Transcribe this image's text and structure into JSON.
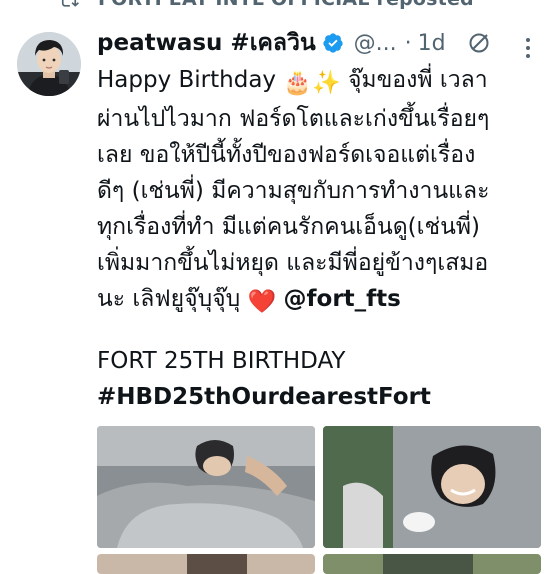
{
  "repost": {
    "label": "FORTPEAT INTL OFFICIAL reposted",
    "icon": "repost-icon"
  },
  "tweet": {
    "display_name": "peatwasu #เคลวิน",
    "verified": true,
    "handle": "@...",
    "separator": "·",
    "time_ago": "1d",
    "body_lines": [
      {
        "text": "Happy Birthday",
        "emoji": "🎂✨",
        "after": " จุ๊มของพี่ เวลา"
      },
      {
        "text": "ผ่านไปไวมาก ฟอร์ดโตและเก่งขึ้นเรื่อยๆ"
      },
      {
        "text": "เลย ขอให้ปีนี้ทั้งปีของฟอร์ดเจอแต่เรื่อง"
      },
      {
        "text": "ดีๆ (เช่นพี่) มีความสุขกับการทำงานและ"
      },
      {
        "text": "ทุกเรื่องที่ทำ มีแต่คนรักคนเอ็นดู(เช่นพี่)"
      },
      {
        "text": "เพิ่มมากขึ้นไม่หยุด และมีพี่อยู่ข้างๆเสมอ"
      },
      {
        "text": "นะ เลิฟยูจุ๊บุจุ๊บุ",
        "emoji": "❤️",
        "mention": "@fort_fts"
      }
    ],
    "section_title": "FORT 25TH BIRTHDAY",
    "hashtag": "#HBD25thOurdearestFort",
    "photos": [
      {
        "name": "photo-sleeping-under-blanket"
      },
      {
        "name": "photo-smiling-in-car"
      },
      {
        "name": "photo-third"
      },
      {
        "name": "photo-fourth"
      }
    ]
  },
  "icons": {
    "verified": "verified-badge-icon",
    "grok": "grok-icon",
    "more": "more-options-icon"
  },
  "colors": {
    "text": "#0f1419",
    "secondary": "#536471",
    "verified": "#1d9bf0",
    "heart": "#e0245e"
  }
}
